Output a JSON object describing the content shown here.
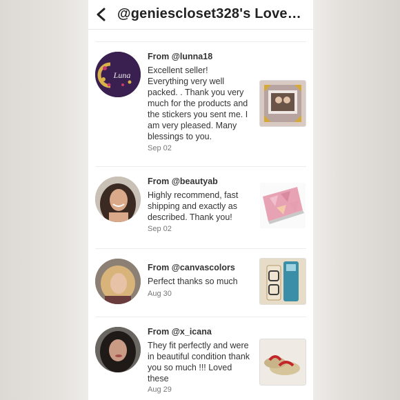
{
  "header": {
    "title": "@geniescloset328's Love…"
  },
  "reviews": [
    {
      "from": "From @lunna18",
      "message": "Excellent seller! Everything very well packed. . Thank you very much for the products and the stickers you sent me. I am very pleased. Many blessings to you.",
      "date": "Sep 02",
      "avatar_text": "Luna"
    },
    {
      "from": "From @beautyab",
      "message": "Highly recommend, fast shipping and exactly as described. Thank you!",
      "date": "Sep 02"
    },
    {
      "from": "From @canvascolors",
      "message": "Perfect thanks so much",
      "date": "Aug 30"
    },
    {
      "from": "From @x_icana",
      "message": "They fit perfectly and were in beautiful condition thank you so much !!! Loved these",
      "date": "Aug 29"
    }
  ]
}
